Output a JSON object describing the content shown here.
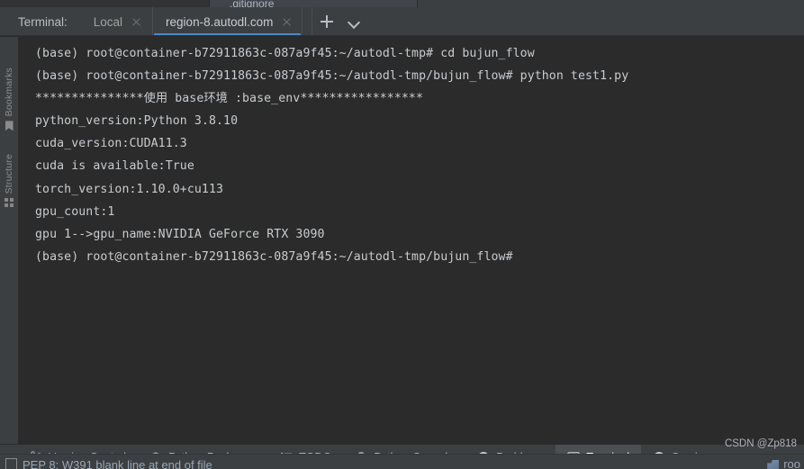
{
  "top_sliver": {
    "partial_editor_tab": ".gitignore"
  },
  "terminal_tabbar": {
    "label": "Terminal:",
    "tabs": [
      {
        "title": "Local",
        "active": false
      },
      {
        "title": "region-8.autodl.com",
        "active": true
      }
    ],
    "add_tab_tooltip": "New Session",
    "options_tooltip": "Options"
  },
  "left_rail": {
    "items": [
      {
        "label": "Bookmarks",
        "icon": "bookmark-icon"
      },
      {
        "label": "Structure",
        "icon": "structure-icon"
      }
    ]
  },
  "terminal": {
    "lines": [
      "(base) root@container-b72911863c-087a9f45:~/autodl-tmp# cd bujun_flow",
      "(base) root@container-b72911863c-087a9f45:~/autodl-tmp/bujun_flow# python test1.py",
      "***************使用 base环境 :base_env*****************",
      "python_version:Python 3.8.10",
      "",
      "cuda_version:CUDA11.3",
      "",
      "cuda is available:True",
      "",
      "torch_version:1.10.0+cu113",
      "",
      "gpu_count:1",
      "",
      "gpu 1-->gpu_name:NVIDIA GeForce RTX 3090",
      "",
      "(base) root@container-b72911863c-087a9f45:~/autodl-tmp/bujun_flow#"
    ]
  },
  "bottom_bar": {
    "buttons": [
      {
        "label": "Version Control",
        "icon": "branch-icon",
        "active": false
      },
      {
        "label": "Python Packages",
        "icon": "packages-icon",
        "active": false
      },
      {
        "label": "TODO",
        "icon": "list-icon",
        "active": false
      },
      {
        "label": "Python Console",
        "icon": "python-icon",
        "active": false
      },
      {
        "label": "Problems",
        "icon": "warning-icon",
        "active": false
      },
      {
        "label": "Terminal",
        "icon": "terminal-icon",
        "active": true
      },
      {
        "label": "Services",
        "icon": "play-circle-icon",
        "active": false
      }
    ]
  },
  "status_strip": {
    "inspection_text": "PEP 8: W391 blank line at end of file",
    "right_text": "roo"
  },
  "watermark": {
    "text": "CSDN @Zp818"
  },
  "colors": {
    "app_background": "#2b2b2b",
    "chrome": "#3c3f41",
    "terminal_text": "#c8ccd0",
    "active_tab_underline": "#4a88c7",
    "active_toolwindow_bg": "#4b4f52"
  }
}
